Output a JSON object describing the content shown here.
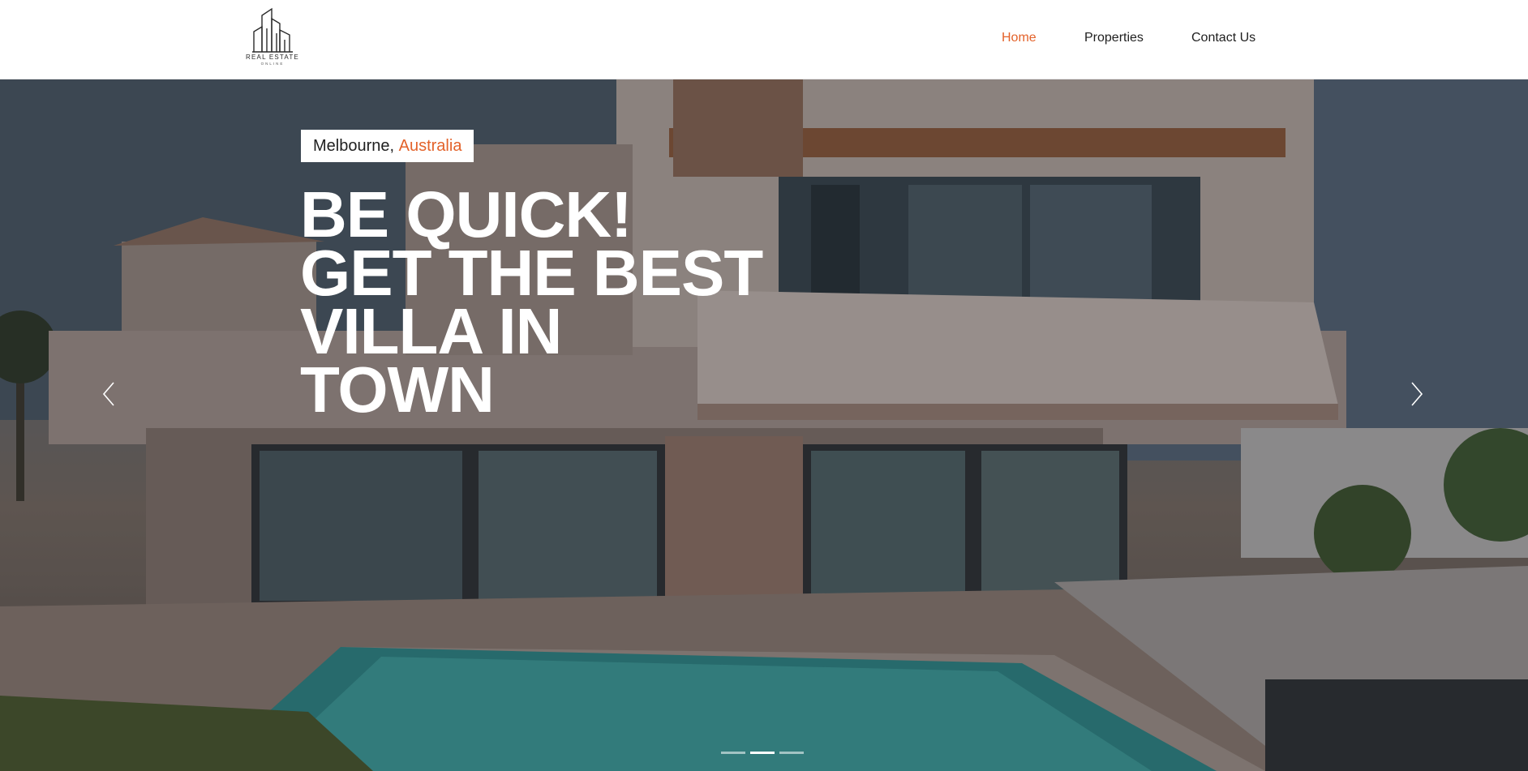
{
  "brand": {
    "name_line1": "REAL ESTATE",
    "name_line2": "ONLINE",
    "logo_icon": "buildings-icon"
  },
  "nav": {
    "items": [
      {
        "label": "Home",
        "active": true
      },
      {
        "label": "Properties",
        "active": false
      },
      {
        "label": "Contact Us",
        "active": false
      }
    ]
  },
  "hero": {
    "location_city": "Melbourne,",
    "location_country": "Australia",
    "headline_lines": [
      "BE QUICK!",
      "GET THE BEST",
      "VILLA IN",
      "TOWN"
    ],
    "prev_icon": "chevron-left-icon",
    "next_icon": "chevron-right-icon",
    "slides": {
      "count": 3,
      "active_index": 2
    }
  },
  "colors": {
    "accent": "#e3622a",
    "text": "#1f1f1f",
    "header_bg": "#ffffff"
  }
}
